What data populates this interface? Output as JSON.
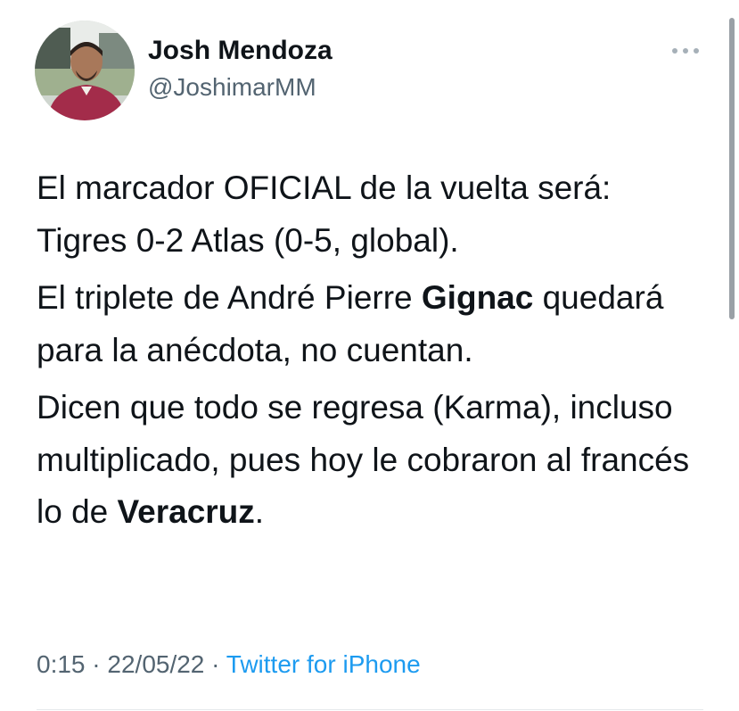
{
  "author": {
    "name": "Josh Mendoza",
    "handle": "@JoshimarMM",
    "avatar_icon": "user-photo"
  },
  "tweet": {
    "paragraph1": "El marcador OFICIAL de la vuelta será: Tigres 0-2 Atlas (0-5, global).",
    "p2_before": "El triplete de André Pierre ",
    "p2_bold": "Gignac",
    "p2_after": " quedará para la anécdota, no cuentan.",
    "p3_before": "Dicen que todo se regresa (Karma), incluso multiplicado, pues hoy le cobraron al francés lo de ",
    "p3_bold": "Veracruz",
    "p3_after": "."
  },
  "meta": {
    "time": "0:15",
    "separator": "·",
    "date": "22/05/22",
    "source": "Twitter for iPhone"
  },
  "colors": {
    "text": "#0f1419",
    "secondary": "#536471",
    "link": "#1d9bf0"
  },
  "icons": {
    "more": "more-horizontal-icon"
  }
}
